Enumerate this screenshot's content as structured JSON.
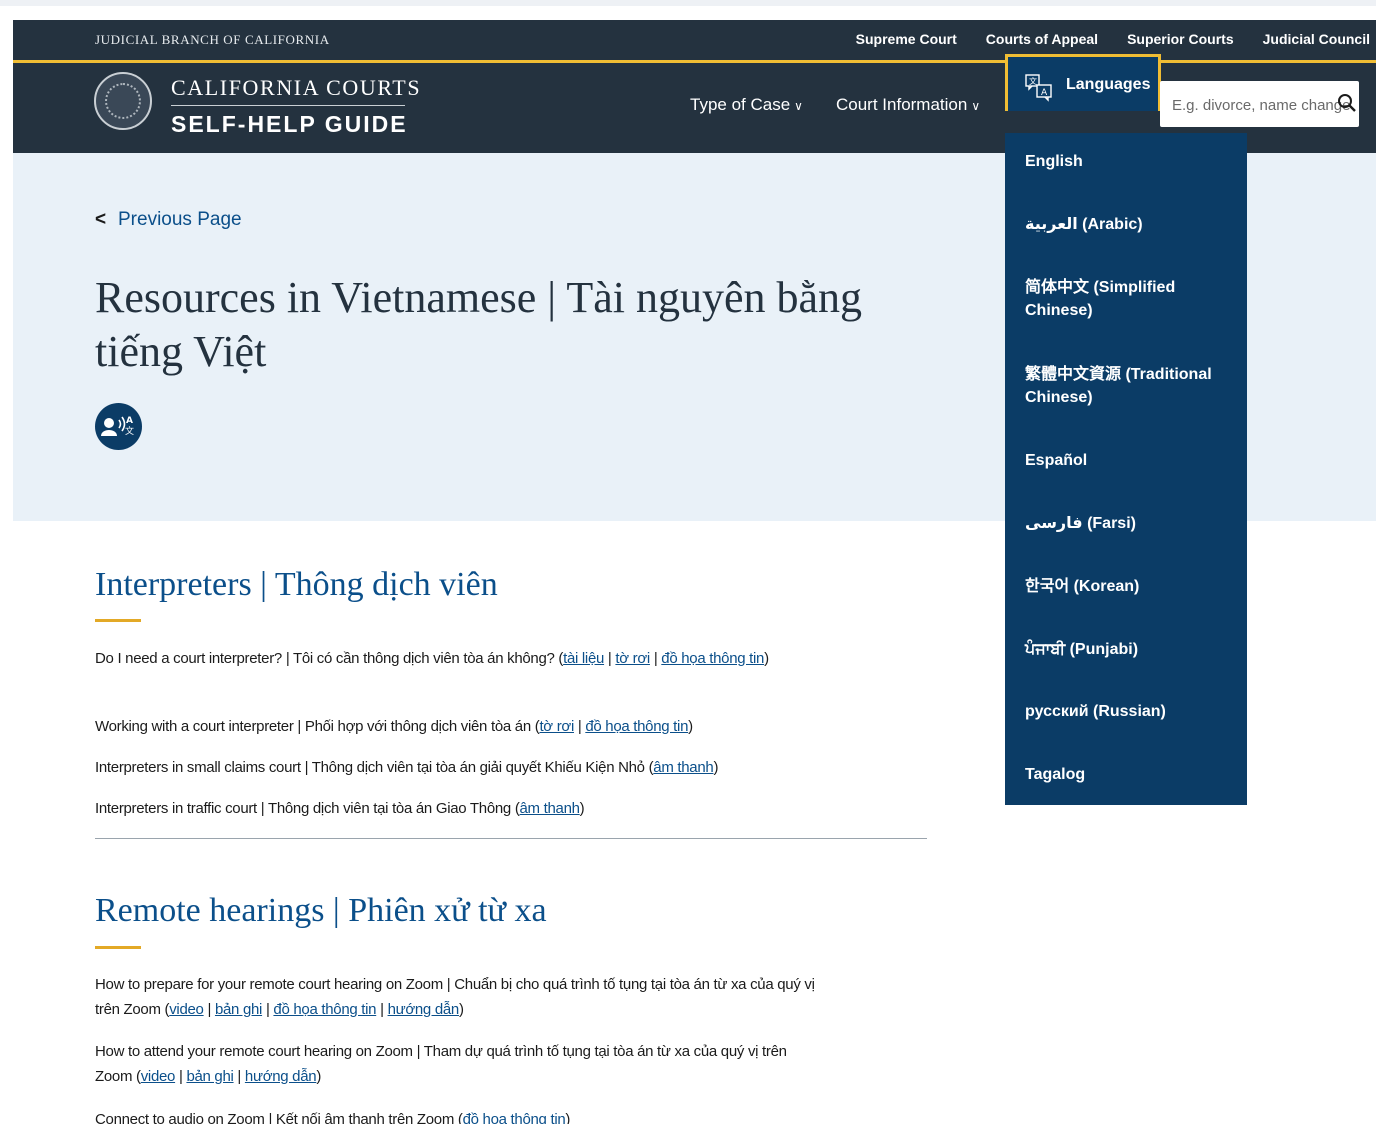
{
  "utility_bar": {
    "branch_name": "JUDICIAL BRANCH OF CALIFORNIA",
    "links": [
      "Supreme Court",
      "Courts of Appeal",
      "Superior Courts",
      "Judicial Council"
    ]
  },
  "header": {
    "brand_top": "CALIFORNIA COURTS",
    "brand_bottom": "SELF-HELP GUIDE",
    "nav": [
      {
        "label": "Type of Case",
        "icon": "chevron-down-icon"
      },
      {
        "label": "Court Information",
        "icon": "chevron-down-icon"
      }
    ],
    "languages": {
      "label": "Languages",
      "icon": "translate-icon",
      "expanded": true
    },
    "search": {
      "placeholder": "E.g. divorce, name change",
      "icon": "search-icon"
    }
  },
  "hero": {
    "back_link": "Previous Page",
    "title": "Resources in Vietnamese | Tài nguyên bằng tiếng Việt",
    "badge_icon": "interpreter-icon"
  },
  "sections": [
    {
      "title": "Interpreters | Thông dịch viên",
      "items": [
        {
          "text": "Do I need a court interpreter? | Tôi có cần thông dịch viên tòa án không? (",
          "links": [
            "tài liệu",
            "tờ rơi",
            "đồ họa thông tin"
          ],
          "suffix": ")"
        },
        {
          "text": "Working with a court interpreter | Phối hợp với thông dịch viên tòa án (",
          "links": [
            "tờ rơi",
            "đồ họa thông tin"
          ],
          "suffix": ")"
        },
        {
          "text": "Interpreters in small claims court | Thông dịch viên tại tòa án giải quyết Khiếu Kiện Nhỏ (",
          "links": [
            "âm thanh"
          ],
          "suffix": ")"
        },
        {
          "text": "Interpreters in traffic court | Thông dịch viên tại tòa án Giao Thông (",
          "links": [
            "âm thanh"
          ],
          "suffix": ")"
        }
      ]
    },
    {
      "title": "Remote hearings | Phiên xử từ xa",
      "items": [
        {
          "text": "How to prepare for your remote court hearing on Zoom | Chuẩn bị cho quá trình tố tụng tại tòa án từ xa của quý vị trên Zoom (",
          "links": [
            "video",
            "bản ghi",
            "đồ họa thông tin",
            "hướng dẫn"
          ],
          "suffix": ")"
        },
        {
          "text": "How to attend your remote court hearing on Zoom | Tham dự quá trình tố tụng tại tòa án từ xa của quý vị trên Zoom (",
          "links": [
            "video",
            "bản ghi",
            "hướng dẫn"
          ],
          "suffix": ")"
        },
        {
          "text": "Connect to audio on Zoom | Kết nối âm thanh trên Zoom (",
          "links": [
            "đồ họa thông tin"
          ],
          "suffix": ")"
        }
      ]
    }
  ],
  "language_menu": [
    "English",
    "العربية (Arabic)",
    "简体中文 (Simplified Chinese)",
    "繁體中文資源 (Traditional Chinese)",
    "Español",
    "فارسی (Farsi)",
    "한국어 (Korean)",
    "ਪੰਜਾਬੀ (Punjabi)",
    "русский (Russian)",
    "Tagalog"
  ],
  "colors": {
    "header_bg": "#24323f",
    "accent_gold": "#f0bd34",
    "menu_bg": "#0b3c66",
    "link": "#0b4f8a",
    "hero_bg": "#e9f1f8"
  }
}
